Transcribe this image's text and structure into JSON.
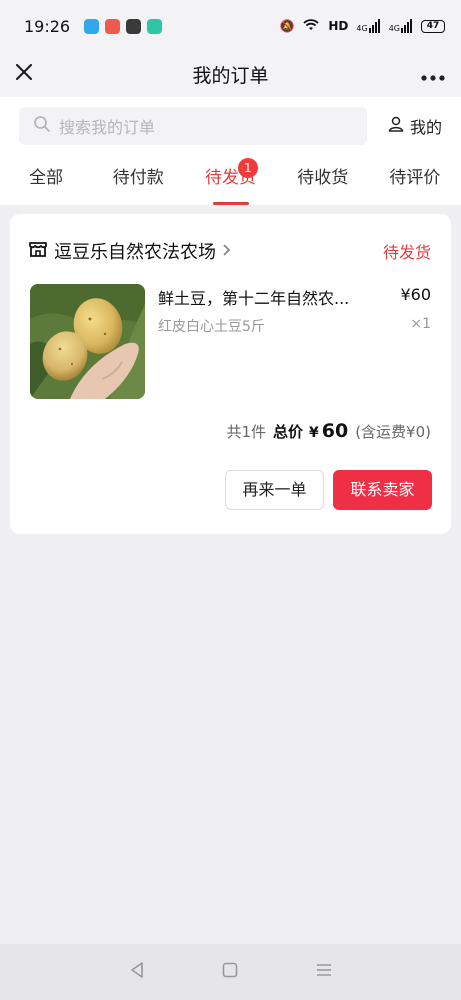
{
  "status_bar": {
    "time": "19:26",
    "network_label": "HD",
    "signal_1": "4G",
    "signal_2": "4G",
    "battery": "47"
  },
  "header": {
    "title": "我的订单",
    "back_icon": "close-icon",
    "more_icon": "more-icon"
  },
  "search": {
    "placeholder": "搜索我的订单",
    "mine_label": "我的"
  },
  "tabs": [
    {
      "label": "全部"
    },
    {
      "label": "待付款"
    },
    {
      "label": "待发货",
      "active": true,
      "badge": "1"
    },
    {
      "label": "待收货"
    },
    {
      "label": "待评价"
    }
  ],
  "order": {
    "shop_name": "逗豆乐自然农法农场",
    "status": "待发货",
    "product": {
      "title": "鲜土豆，第十二年自然农法种植",
      "title_display": "鲜土豆，第十二年自然农...",
      "spec": "红皮白心土豆5斤",
      "price": "¥60",
      "quantity": "×1"
    },
    "summary": {
      "count_text": "共1件",
      "total_label": "总价",
      "currency": "¥",
      "total_amount": "60",
      "shipping_text": "(含运费¥0)"
    },
    "buttons": {
      "rebuy": "再来一单",
      "contact": "联系卖家"
    }
  },
  "colors": {
    "accent": "#e23c3c",
    "contact_button": "#ef2f45",
    "background": "#f0f0f2"
  }
}
